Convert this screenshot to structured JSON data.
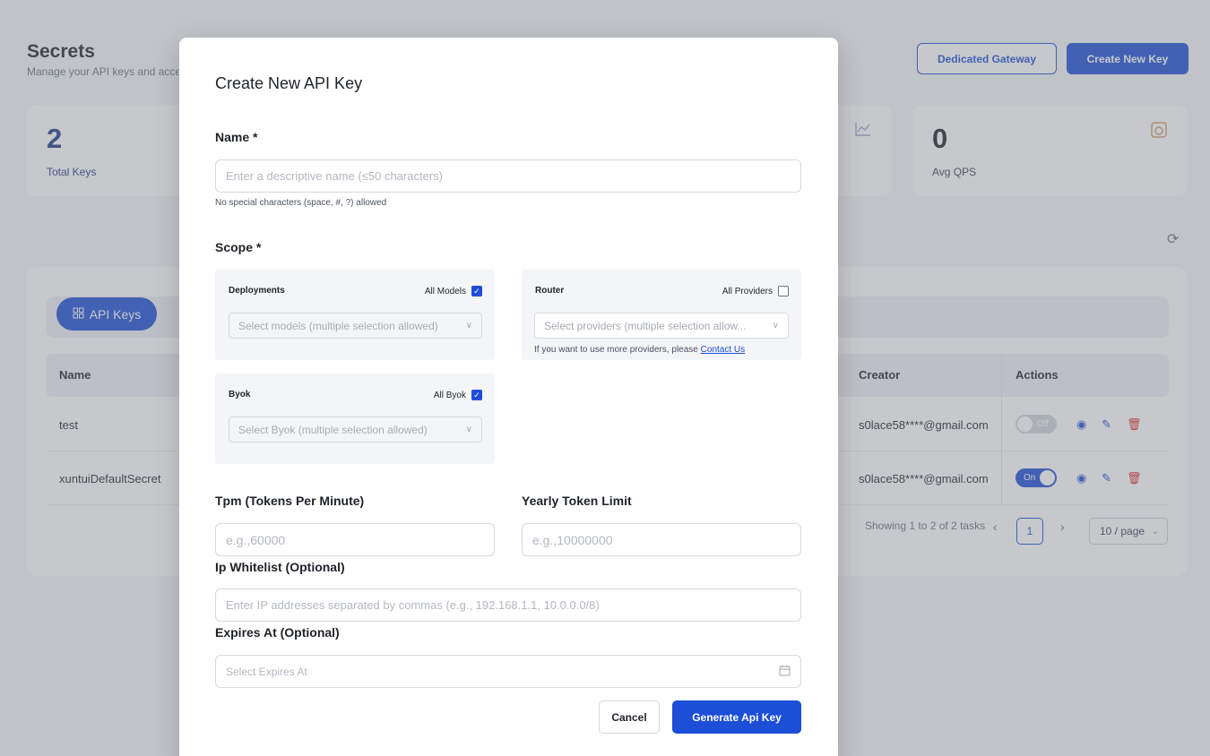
{
  "page": {
    "title": "Secrets",
    "subtitle": "Manage your API keys and acce",
    "dedicated_gateway_label": "Dedicated Gateway",
    "create_key_label": "Create New Key"
  },
  "stats": [
    {
      "value": "2",
      "label": "Total Keys",
      "icon": "key-icon"
    },
    {
      "value": "",
      "label": "",
      "icon": "line-chart-icon"
    },
    {
      "value": "0",
      "label": "Avg QPS",
      "icon": "gauge-icon"
    }
  ],
  "tabs": {
    "api_keys_label": "API Keys"
  },
  "table": {
    "columns": {
      "name": "Name",
      "creator": "Creator",
      "actions": "Actions"
    },
    "rows": [
      {
        "name": "test",
        "creator": "s0lace58****@gmail.com",
        "status": "Off",
        "enabled": false
      },
      {
        "name": "xuntuiDefaultSecret",
        "creator": "s0lace58****@gmail.com",
        "status": "On",
        "enabled": true
      }
    ],
    "pagination": {
      "summary": "Showing 1 to 2 of 2 tasks",
      "current_page": "1",
      "page_size": "10 / page"
    }
  },
  "modal": {
    "title": "Create New API Key",
    "name": {
      "label": "Name *",
      "placeholder": "Enter a descriptive name (≤50 characters)",
      "hint": "No special characters (space, #, ?) allowed"
    },
    "scope": {
      "label": "Scope *",
      "deployments": {
        "title": "Deployments",
        "all_label": "All Models",
        "checked": true,
        "placeholder": "Select models (multiple selection allowed)"
      },
      "router": {
        "title": "Router",
        "all_label": "All Providers",
        "checked": false,
        "placeholder": "Select providers (multiple selection allow...",
        "hint": "If you want to use more providers, please",
        "link": "Contact Us"
      },
      "byok": {
        "title": "Byok",
        "all_label": "All Byok",
        "checked": true,
        "placeholder": "Select Byok (multiple selection allowed)"
      }
    },
    "tpm": {
      "label": "Tpm (Tokens Per Minute)",
      "placeholder": "e.g.,60000"
    },
    "yearly": {
      "label": "Yearly Token Limit",
      "placeholder": "e.g.,10000000"
    },
    "ip": {
      "label": "Ip Whitelist (Optional)",
      "placeholder": "Enter IP addresses separated by commas (e.g., 192.168.1.1, 10.0.0.0/8)"
    },
    "expires": {
      "label": "Expires At (Optional)",
      "placeholder": "Select Expires At"
    },
    "cancel_label": "Cancel",
    "generate_label": "Generate Api Key"
  },
  "colors": {
    "accent": "#1d4ed8",
    "danger": "#dc2626",
    "overlay": "rgba(120,124,132,0.42)"
  }
}
